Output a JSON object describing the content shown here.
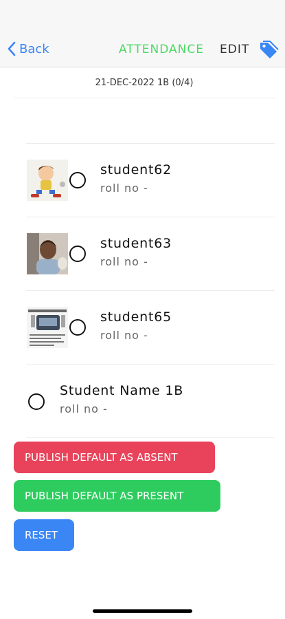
{
  "nav": {
    "back_label": "Back",
    "title": "ATTENDANCE",
    "edit_label": "EDIT",
    "tag_icon": "tag-icon"
  },
  "subheader": "21-DEC-2022 1B (0/4)",
  "students": [
    {
      "name": "student62",
      "roll": "roll no -",
      "has_photo": true,
      "photo": "cartoon-boy"
    },
    {
      "name": "student63",
      "roll": "roll no -",
      "has_photo": true,
      "photo": "child-photo"
    },
    {
      "name": "student65",
      "roll": "roll no -",
      "has_photo": true,
      "photo": "document-image"
    },
    {
      "name": "Student Name 1B",
      "roll": "roll no -",
      "has_photo": false
    }
  ],
  "buttons": {
    "publish_absent": "PUBLISH DEFAULT AS ABSENT",
    "publish_present": "PUBLISH DEFAULT AS PRESENT",
    "reset": "RESET"
  },
  "colors": {
    "accent_blue": "#3b86f5",
    "title_green": "#4cd964",
    "absent_red": "#e8435a",
    "present_green": "#2ecc5e"
  }
}
